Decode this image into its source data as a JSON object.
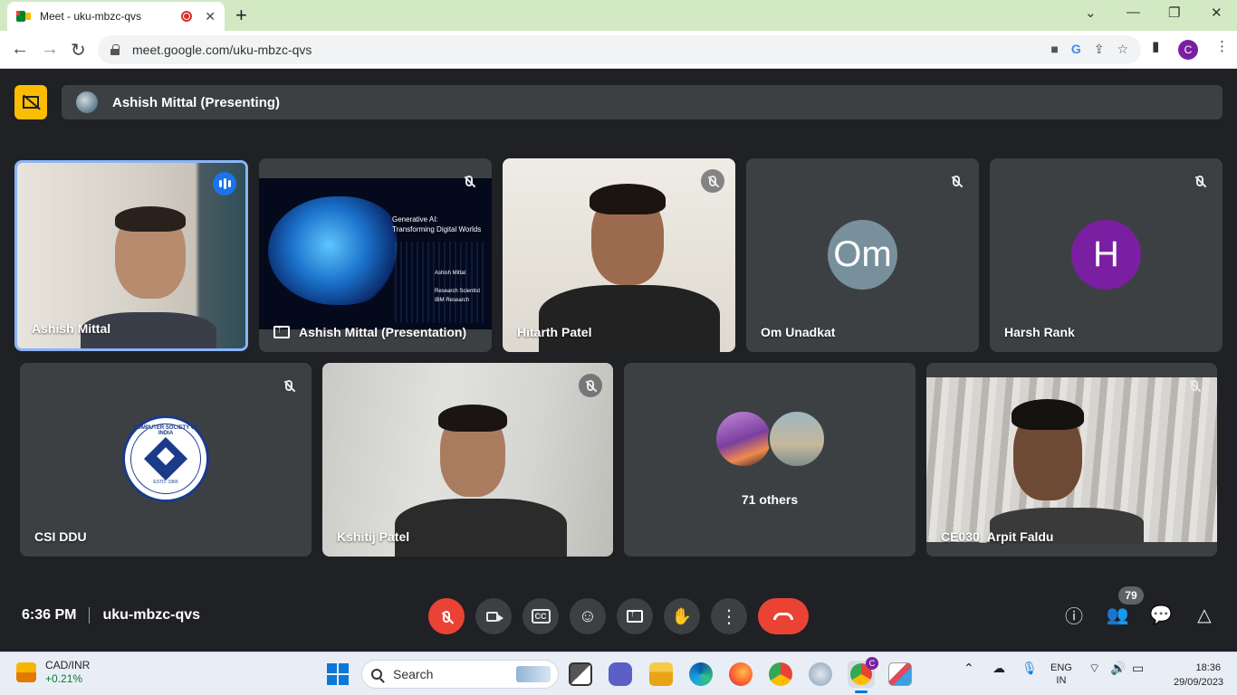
{
  "browser": {
    "tab_title": "Meet - uku-mbzc-qvs",
    "tab_close": "✕",
    "new_tab": "+",
    "url": "meet.google.com/uku-mbzc-qvs",
    "profile_initial": "C",
    "window_controls": {
      "dropdown": "⌄",
      "minimize": "—",
      "restore": "❐",
      "close": "✕"
    },
    "nav": {
      "back": "←",
      "forward": "→",
      "reload": "↻"
    }
  },
  "meet": {
    "presenting_label": "Ashish Mittal (Presenting)",
    "tiles": [
      {
        "name": "Ashish Mittal",
        "state": "speaking"
      },
      {
        "name": "Ashish Mittal (Presentation)",
        "state": "muted"
      },
      {
        "name": "Hitarth Patel",
        "state": "muted"
      },
      {
        "name": "Om Unadkat",
        "avatar_text": "Om",
        "avatar_color": "#78909c",
        "state": "muted"
      },
      {
        "name": "Harsh Rank",
        "avatar_text": "H",
        "avatar_color": "#7b1fa2",
        "state": "muted"
      },
      {
        "name": "CSI DDU",
        "state": "muted"
      },
      {
        "name": "Kshitij Patel",
        "state": "muted"
      },
      {
        "name": "",
        "others_label": "71 others"
      },
      {
        "name": "CE030_Arpit Faldu",
        "state": "muted"
      }
    ],
    "slide": {
      "title_line1": "Generative AI:",
      "title_line2": "Transforming Digital Worlds",
      "presenter": "Ashish Mittal",
      "role_line1": "Research Scientist",
      "role_line2": "IBM Research"
    },
    "csi_logo": {
      "ring_text": "COMPUTER SOCIETY OF INDIA",
      "estd": "ESTD. 1965"
    },
    "bottom": {
      "time": "6:36 PM",
      "meeting_code": "uku-mbzc-qvs",
      "participant_count": "79"
    },
    "colors": {
      "accent": "#1a73e8",
      "danger": "#ea4335",
      "presenting": "#fbbc04"
    }
  },
  "taskbar": {
    "ticker": "CAD/INR",
    "ticker_change": "+0.21%",
    "search_label": "Search",
    "language_line1": "ENG",
    "language_line2": "IN",
    "clock_time": "18:36",
    "clock_date": "29/09/2023",
    "chrome_badge": "C"
  }
}
